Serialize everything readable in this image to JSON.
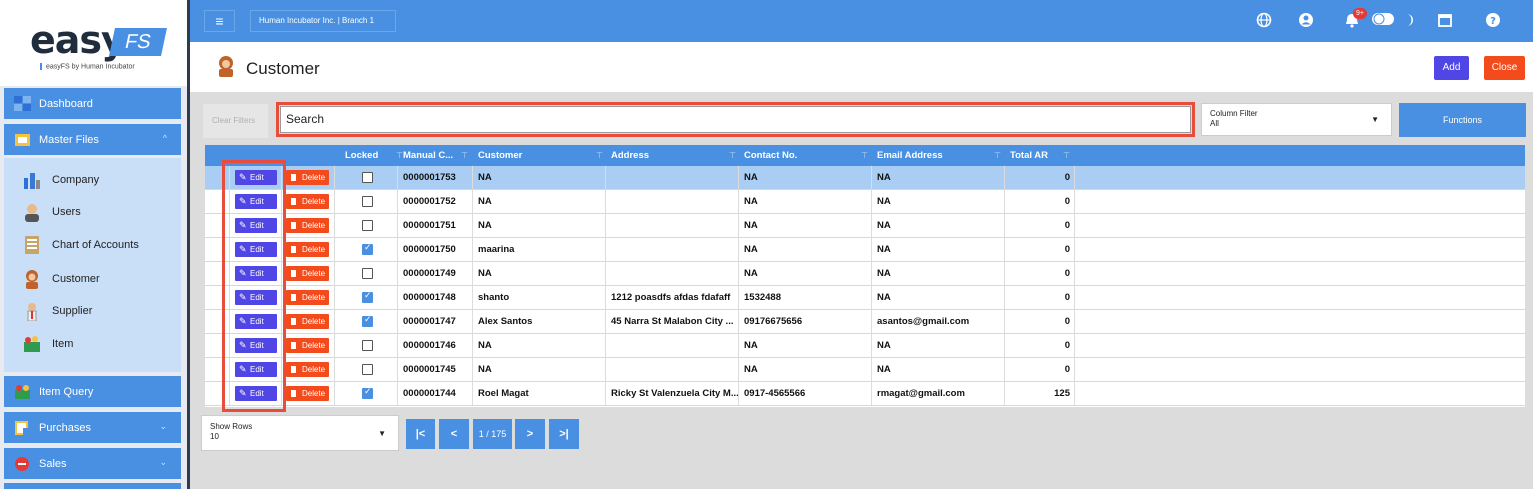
{
  "app": {
    "logo_word": "easy",
    "logo_tag": "FS",
    "logo_sub": "easyFS by Human Incubator",
    "branch": "Human Incubator Inc. | Branch 1",
    "notifications": "9+"
  },
  "sidebar": {
    "main": [
      {
        "label": "Dashboard",
        "icon": "dashboard-icon"
      },
      {
        "label": "Master Files",
        "icon": "folder-icon",
        "chevron": "^"
      },
      {
        "label": "Item Query",
        "icon": "basket-icon"
      },
      {
        "label": "Purchases",
        "icon": "purchases-icon",
        "chevron": "⌄"
      },
      {
        "label": "Sales",
        "icon": "sales-icon",
        "chevron": "⌄"
      }
    ],
    "sub": [
      {
        "label": "Company",
        "icon": "company-icon"
      },
      {
        "label": "Users",
        "icon": "users-icon"
      },
      {
        "label": "Chart of Accounts",
        "icon": "accounts-icon"
      },
      {
        "label": "Customer",
        "icon": "customer-icon"
      },
      {
        "label": "Supplier",
        "icon": "supplier-icon"
      },
      {
        "label": "Item",
        "icon": "item-icon"
      }
    ]
  },
  "page": {
    "title": "Customer",
    "add_label": "Add",
    "close_label": "Close"
  },
  "filters": {
    "clear_label": "Clear Filters",
    "search_value": "Search",
    "column_filter_label": "Column Filter",
    "column_filter_value": "All",
    "functions_label": "Functions"
  },
  "table": {
    "headers": [
      "Locked",
      "Manual C...",
      "Customer",
      "Address",
      "Contact No.",
      "Email Address",
      "Total AR"
    ],
    "edit_label": "Edit",
    "delete_label": "Delete",
    "rows": [
      {
        "locked": false,
        "code": "0000001753",
        "customer": "NA",
        "address": "",
        "contact": "NA",
        "email": "NA",
        "total": "0"
      },
      {
        "locked": false,
        "code": "0000001752",
        "customer": "NA",
        "address": "",
        "contact": "NA",
        "email": "NA",
        "total": "0"
      },
      {
        "locked": false,
        "code": "0000001751",
        "customer": "NA",
        "address": "",
        "contact": "NA",
        "email": "NA",
        "total": "0"
      },
      {
        "locked": true,
        "code": "0000001750",
        "customer": "maarina",
        "address": "",
        "contact": "NA",
        "email": "NA",
        "total": "0"
      },
      {
        "locked": false,
        "code": "0000001749",
        "customer": "NA",
        "address": "",
        "contact": "NA",
        "email": "NA",
        "total": "0"
      },
      {
        "locked": true,
        "code": "0000001748",
        "customer": "shanto",
        "address": "1212 poasdfs afdas fdafaff",
        "contact": "1532488",
        "email": "NA",
        "total": "0"
      },
      {
        "locked": true,
        "code": "0000001747",
        "customer": "Alex Santos",
        "address": "45 Narra St Malabon City ...",
        "contact": "09176675656",
        "email": "asantos@gmail.com",
        "total": "0"
      },
      {
        "locked": false,
        "code": "0000001746",
        "customer": "NA",
        "address": "",
        "contact": "NA",
        "email": "NA",
        "total": "0"
      },
      {
        "locked": false,
        "code": "0000001745",
        "customer": "NA",
        "address": "",
        "contact": "NA",
        "email": "NA",
        "total": "0"
      },
      {
        "locked": true,
        "code": "0000001744",
        "customer": "Roel Magat",
        "address": "Ricky St Valenzuela City M...",
        "contact": "0917-4565566",
        "email": "rmagat@gmail.com",
        "total": "125"
      }
    ]
  },
  "pager": {
    "show_rows_label": "Show Rows",
    "show_rows_value": "10",
    "page_info": "1 / 175",
    "first": "|<",
    "prev": "<",
    "next": ">",
    "last": ">|"
  },
  "colors": {
    "primary": "#4a90e2",
    "edit": "#4f46e5",
    "delete": "#f34b1c",
    "highlight": "#e74c3c",
    "selected_row": "#a9cdf3"
  }
}
